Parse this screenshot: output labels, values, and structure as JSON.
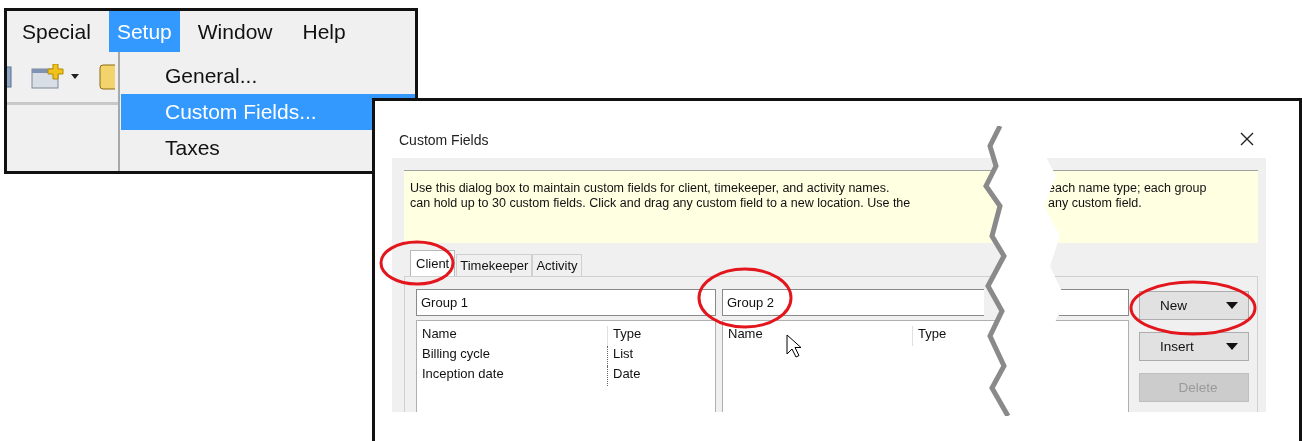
{
  "menu_bar": {
    "items": [
      {
        "label": "Special",
        "selected": false
      },
      {
        "label": "Setup",
        "selected": true
      },
      {
        "label": "Window",
        "selected": false
      },
      {
        "label": "Help",
        "selected": false
      }
    ]
  },
  "setup_menu": {
    "items": [
      {
        "label": "General...",
        "selected": false
      },
      {
        "label": "Custom Fields...",
        "selected": true
      },
      {
        "label": "Taxes",
        "selected": false
      }
    ]
  },
  "dialog": {
    "title": "Custom Fields",
    "info": {
      "left_lines": [
        "Use this dialog box to maintain custom fields for client, timekeeper, and activity names.",
        "can hold up to 30 custom fields. Click and drag any custom field to a new location. Use the"
      ],
      "right_lines": [
        "each name type; each group",
        "any custom field."
      ]
    },
    "tabs": [
      {
        "label": "Client",
        "selected": true
      },
      {
        "label": "Timekeeper",
        "selected": false
      },
      {
        "label": "Activity",
        "selected": false
      }
    ],
    "groups": [
      {
        "name": "Group 1",
        "columns": [
          "Name",
          "Type"
        ],
        "rows": [
          {
            "name": "Billing cycle",
            "type": "List"
          },
          {
            "name": "Inception date",
            "type": "Date"
          }
        ]
      },
      {
        "name": "Group 2",
        "columns": [
          "Name",
          "Type"
        ]
      }
    ],
    "buttons": [
      {
        "label": "New",
        "menu": true,
        "disabled": false
      },
      {
        "label": "Insert",
        "menu": true,
        "disabled": false
      },
      {
        "label": "Delete",
        "menu": false,
        "disabled": true
      }
    ]
  }
}
